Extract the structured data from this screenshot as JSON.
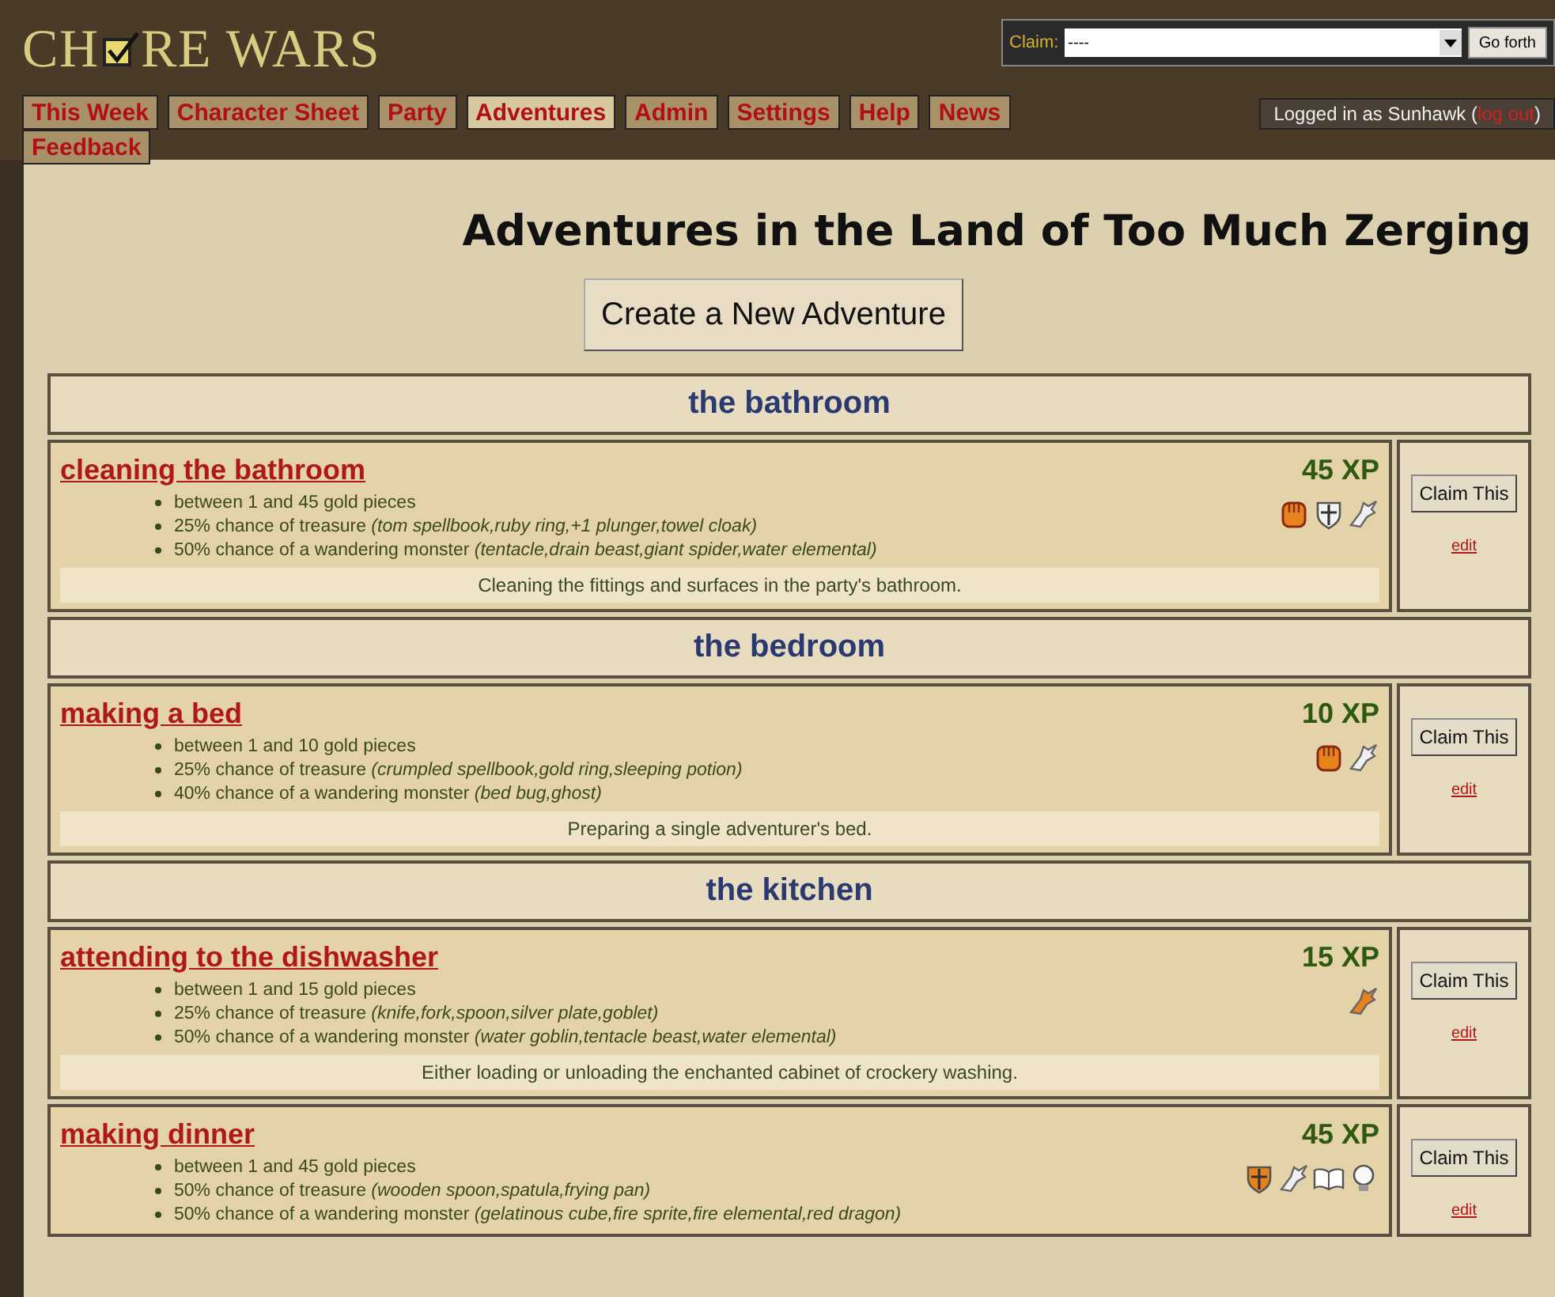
{
  "logo": {
    "before": "CH",
    "after": "RE WARS"
  },
  "claim": {
    "label": "Claim:",
    "value": "----",
    "button": "Go forth"
  },
  "tabs": [
    {
      "label": "This Week",
      "selected": false
    },
    {
      "label": "Character Sheet",
      "selected": false
    },
    {
      "label": "Party",
      "selected": false
    },
    {
      "label": "Adventures",
      "selected": true
    },
    {
      "label": "Admin",
      "selected": false
    },
    {
      "label": "Settings",
      "selected": false
    },
    {
      "label": "Help",
      "selected": false
    },
    {
      "label": "News",
      "selected": false
    },
    {
      "label": "Feedback",
      "selected": false
    }
  ],
  "login": {
    "text": "Logged in as Sunhawk (",
    "link": "log out",
    "close": ")"
  },
  "title": "Adventures in the Land of Too Much Zerging",
  "create_button": "Create a New Adventure",
  "rooms": [
    {
      "name": "the bathroom",
      "adventures": [
        {
          "title": "cleaning the bathroom",
          "xp": "45 XP",
          "gold": "between 1 and 45 gold pieces",
          "treasure": "25% chance of treasure",
          "treasure_items": "(tom spellbook,ruby ring,+1 plunger,towel cloak)",
          "monster": "50% chance of a wandering monster",
          "monster_items": "(tentacle,drain beast,giant spider,water elemental)",
          "description": "Cleaning the fittings and surfaces in the party's bathroom.",
          "icons": [
            {
              "kind": "fist"
            },
            {
              "kind": "shield"
            },
            {
              "kind": "boot"
            }
          ],
          "claim": "Claim This",
          "edit": "edit"
        }
      ]
    },
    {
      "name": "the bedroom",
      "adventures": [
        {
          "title": "making a bed",
          "xp": "10 XP",
          "gold": "between 1 and 10 gold pieces",
          "treasure": "25% chance of treasure",
          "treasure_items": "(crumpled spellbook,gold ring,sleeping potion)",
          "monster": "40% chance of a wandering monster",
          "monster_items": "(bed bug,ghost)",
          "description": "Preparing a single adventurer's bed.",
          "icons": [
            {
              "kind": "fist"
            },
            {
              "kind": "boot"
            }
          ],
          "claim": "Claim This",
          "edit": "edit"
        }
      ]
    },
    {
      "name": "the kitchen",
      "adventures": [
        {
          "title": "attending to the dishwasher",
          "xp": "15 XP",
          "gold": "between 1 and 15 gold pieces",
          "treasure": "25% chance of treasure",
          "treasure_items": "(knife,fork,spoon,silver plate,goblet)",
          "monster": "50% chance of a wandering monster",
          "monster_items": "(water goblin,tentacle beast,water elemental)",
          "description": "Either loading or unloading the enchanted cabinet of crockery washing.",
          "icons": [
            {
              "kind": "gold-boot"
            }
          ],
          "claim": "Claim This",
          "edit": "edit"
        },
        {
          "title": "making dinner",
          "xp": "45 XP",
          "gold": "between 1 and 45 gold pieces",
          "treasure": "50% chance of treasure",
          "treasure_items": "(wooden spoon,spatula,frying pan)",
          "monster": "50% chance of a wandering monster",
          "monster_items": "(gelatinous cube,fire sprite,fire elemental,red dragon)",
          "icons": [
            {
              "kind": "gold-shield"
            },
            {
              "kind": "boot"
            },
            {
              "kind": "book"
            },
            {
              "kind": "bulb"
            }
          ],
          "claim": "Claim This",
          "edit": "edit"
        }
      ]
    }
  ]
}
